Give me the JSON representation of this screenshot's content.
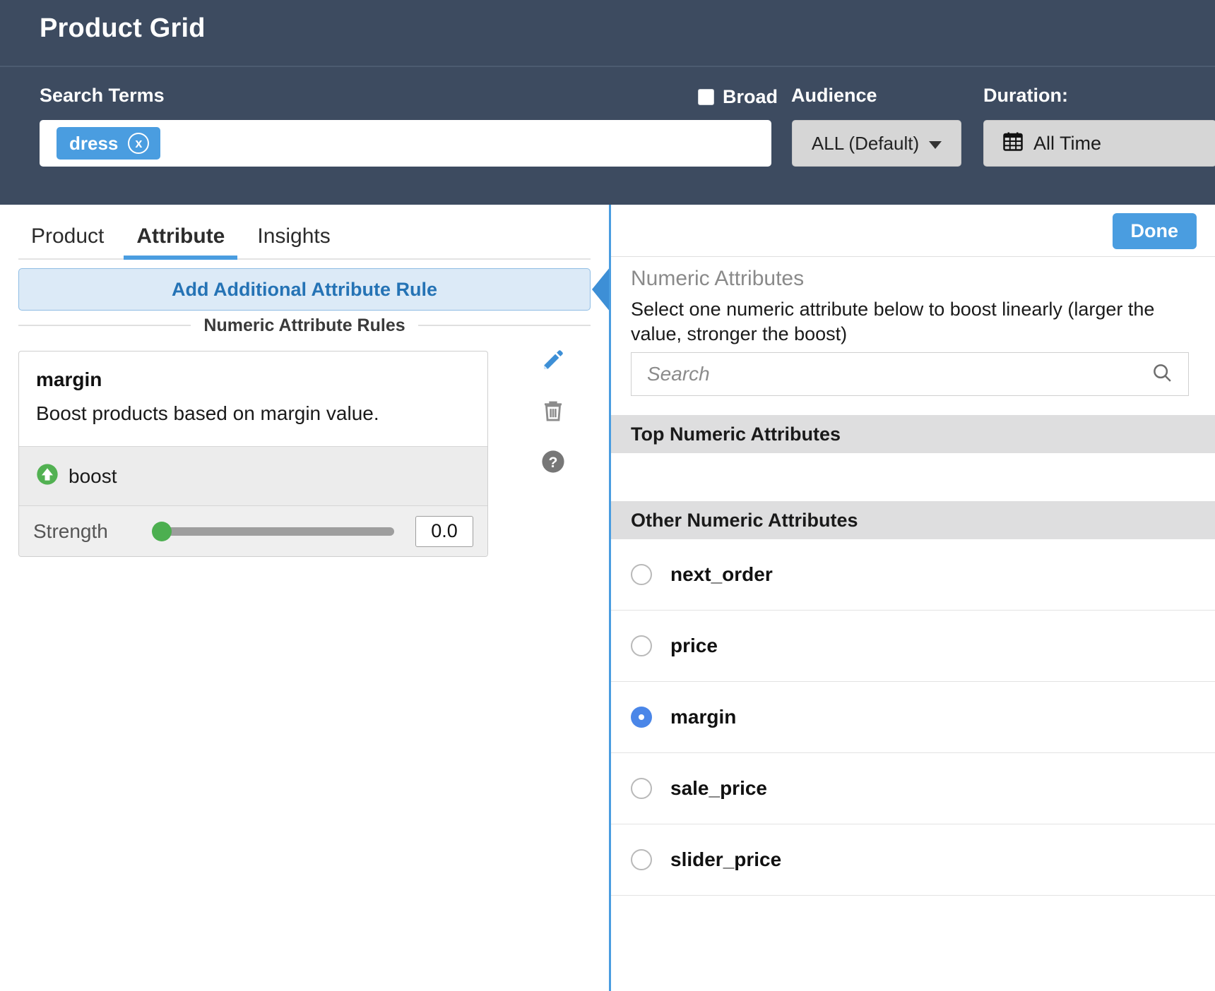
{
  "header": {
    "title": "Product Grid",
    "search_terms_label": "Search Terms",
    "search_chip": "dress",
    "chip_close": "x",
    "broad_label": "Broad",
    "audience_label": "Audience",
    "audience_value": "ALL (Default)",
    "duration_label": "Duration:",
    "duration_value": "All Time"
  },
  "left": {
    "tabs": [
      {
        "label": "Product"
      },
      {
        "label": "Attribute"
      },
      {
        "label": "Insights"
      }
    ],
    "add_rule_label": "Add Additional Attribute Rule",
    "rules_section_label": "Numeric Attribute Rules",
    "rule": {
      "title": "margin",
      "description": "Boost products based on margin value.",
      "action": "boost",
      "strength_label": "Strength",
      "strength_value": "0.0"
    }
  },
  "right": {
    "done_label": "Done",
    "heading": "Numeric Attributes",
    "subtitle": "Select one numeric attribute below to boost linearly (larger the value, stronger the boost)",
    "search_placeholder": "Search",
    "search_value": "",
    "group_top_label": "Top Numeric Attributes",
    "group_other_label": "Other Numeric Attributes",
    "attributes": [
      {
        "name": "next_order",
        "selected": false
      },
      {
        "name": "price",
        "selected": false
      },
      {
        "name": "margin",
        "selected": true
      },
      {
        "name": "sale_price",
        "selected": false
      },
      {
        "name": "slider_price",
        "selected": false
      }
    ]
  },
  "colors": {
    "header_bg": "#3d4b60",
    "accent_blue": "#4a9de0",
    "selected_radio": "#4a86e8",
    "boost_green": "#4caf50"
  }
}
